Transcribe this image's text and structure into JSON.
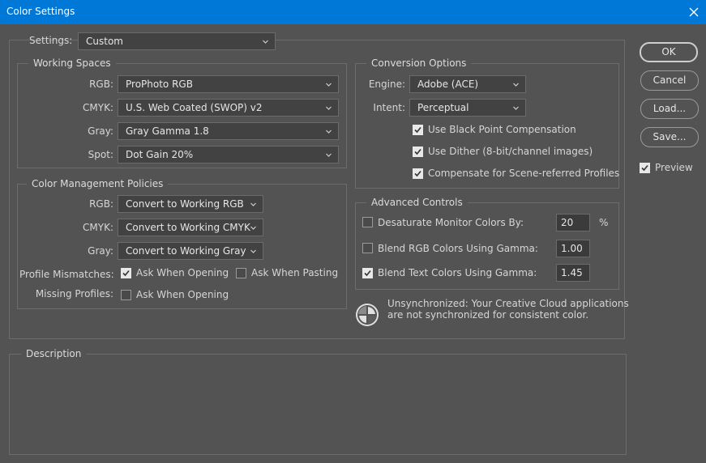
{
  "window": {
    "title": "Color Settings"
  },
  "settings": {
    "label": "Settings:",
    "value": "Custom"
  },
  "working_spaces": {
    "title": "Working Spaces",
    "rows": [
      {
        "label": "RGB:",
        "value": "ProPhoto RGB"
      },
      {
        "label": "CMYK:",
        "value": "U.S. Web Coated (SWOP) v2"
      },
      {
        "label": "Gray:",
        "value": "Gray Gamma 1.8"
      },
      {
        "label": "Spot:",
        "value": "Dot Gain 20%"
      }
    ]
  },
  "policies": {
    "title": "Color Management Policies",
    "rows": [
      {
        "label": "RGB:",
        "value": "Convert to Working RGB"
      },
      {
        "label": "CMYK:",
        "value": "Convert to Working CMYK"
      },
      {
        "label": "Gray:",
        "value": "Convert to Working Gray"
      }
    ],
    "profile_mismatches": {
      "label": "Profile Mismatches:",
      "ask_opening": {
        "label": "Ask When Opening",
        "checked": true
      },
      "ask_pasting": {
        "label": "Ask When Pasting",
        "checked": false
      }
    },
    "missing_profiles": {
      "label": "Missing Profiles:",
      "ask_opening": {
        "label": "Ask When Opening",
        "checked": false
      }
    }
  },
  "conversion": {
    "title": "Conversion Options",
    "engine": {
      "label": "Engine:",
      "value": "Adobe (ACE)"
    },
    "intent": {
      "label": "Intent:",
      "value": "Perceptual"
    },
    "options": [
      {
        "label": "Use Black Point Compensation",
        "checked": true
      },
      {
        "label": "Use Dither (8-bit/channel images)",
        "checked": true
      },
      {
        "label": "Compensate for Scene-referred Profiles",
        "checked": true
      }
    ]
  },
  "advanced": {
    "title": "Advanced Controls",
    "desaturate": {
      "label": "Desaturate Monitor Colors By:",
      "value": "20",
      "unit": "%",
      "checked": false
    },
    "blend_rgb": {
      "label": "Blend RGB Colors Using Gamma:",
      "value": "1.00",
      "checked": false
    },
    "blend_text": {
      "label": "Blend Text Colors Using Gamma:",
      "value": "1.45",
      "checked": true
    }
  },
  "sync": {
    "icon": "sync-status-icon",
    "line1": "Unsynchronized: Your Creative Cloud applications",
    "line2": "are not synchronized for consistent color."
  },
  "description": {
    "title": "Description",
    "text": ""
  },
  "buttons": {
    "ok": "OK",
    "cancel": "Cancel",
    "load": "Load...",
    "save": "Save..."
  },
  "preview": {
    "label": "Preview",
    "checked": true
  },
  "colors": {
    "titlebar": "#0078d7",
    "background": "#535353",
    "field": "#424242"
  }
}
